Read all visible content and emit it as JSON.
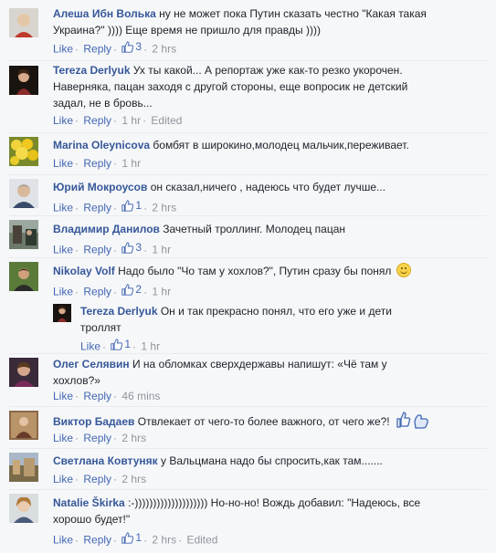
{
  "comments": [
    {
      "author": "Алеша Ибн Волька",
      "text": "ну не может пока Путин сказать честно \"Какая такая",
      "text2": "Украина?\" )))) Еще время не пришло для правды ))))",
      "like": "Like",
      "reply": "Reply",
      "likes": "3",
      "time": "2 hrs"
    },
    {
      "author": "Tereza Derlyuk",
      "text": "Ух ты какой... А репортаж уже как-то резко укорочен.",
      "text2": "Наверняка, пацан заходя с другой стороны, еще вопросик не детский",
      "text3": "задал, не в бровь...",
      "like": "Like",
      "reply": "Reply",
      "time": "1 hr",
      "edited": "Edited"
    },
    {
      "author": "Marina Oleynicova",
      "text": "бомбят в широкино,молодец мальчик,переживает.",
      "like": "Like",
      "reply": "Reply",
      "time": "1 hr"
    },
    {
      "author": "Юрий Мокроусов",
      "text": "он сказал,ничего , надеюсь что будет лучше...",
      "like": "Like",
      "reply": "Reply",
      "likes": "1",
      "time": "2 hrs"
    },
    {
      "author": "Владимир Данилов",
      "text": "Зачетный троллинг. Молодец пацан",
      "like": "Like",
      "reply": "Reply",
      "likes": "3",
      "time": "1 hr"
    },
    {
      "author": "Nikolay Volf",
      "text": "Надо было \"Чо там у хохлов?\", Путин сразу бы понял",
      "like": "Like",
      "reply": "Reply",
      "likes": "2",
      "time": "1 hr"
    },
    {
      "author": "Tereza Derlyuk",
      "text": "Он и так прекрасно понял, что его уже и дети",
      "text2": "троллят",
      "like": "Like",
      "likes": "1",
      "time": "1 hr"
    },
    {
      "author": "Олег Селявин",
      "text": "И на обломках сверхдержавы напишут: «Чё там у",
      "text2": "хохлов?»",
      "like": "Like",
      "reply": "Reply",
      "time": "46 mins"
    },
    {
      "author": "Виктор Бадаев",
      "text": "Отвлекает от чего-то более важного, от чего же?!",
      "like": "Like",
      "reply": "Reply",
      "time": "2 hrs"
    },
    {
      "author": "Светлана Ковтуняк",
      "text": "у Вальцмана надо бы спросить,как там.......",
      "like": "Like",
      "reply": "Reply",
      "time": "2 hrs"
    },
    {
      "author": "Natalie Škirka",
      "text": ":-)))))))))))))))))))) Но-но-но! Вождь добавил: \"Надеюсь, все",
      "text2": "хорошо будет!\"",
      "like": "Like",
      "reply": "Reply",
      "likes": "1",
      "time": "2 hrs",
      "edited": "Edited"
    }
  ],
  "colors": {
    "link": "#4267b2",
    "author": "#365899",
    "meta": "#90949c",
    "background": "#f6f7f9"
  },
  "icons": [
    "like-thumb-icon",
    "smiley-emoji-icon",
    "sticker-thumbs-icon"
  ]
}
